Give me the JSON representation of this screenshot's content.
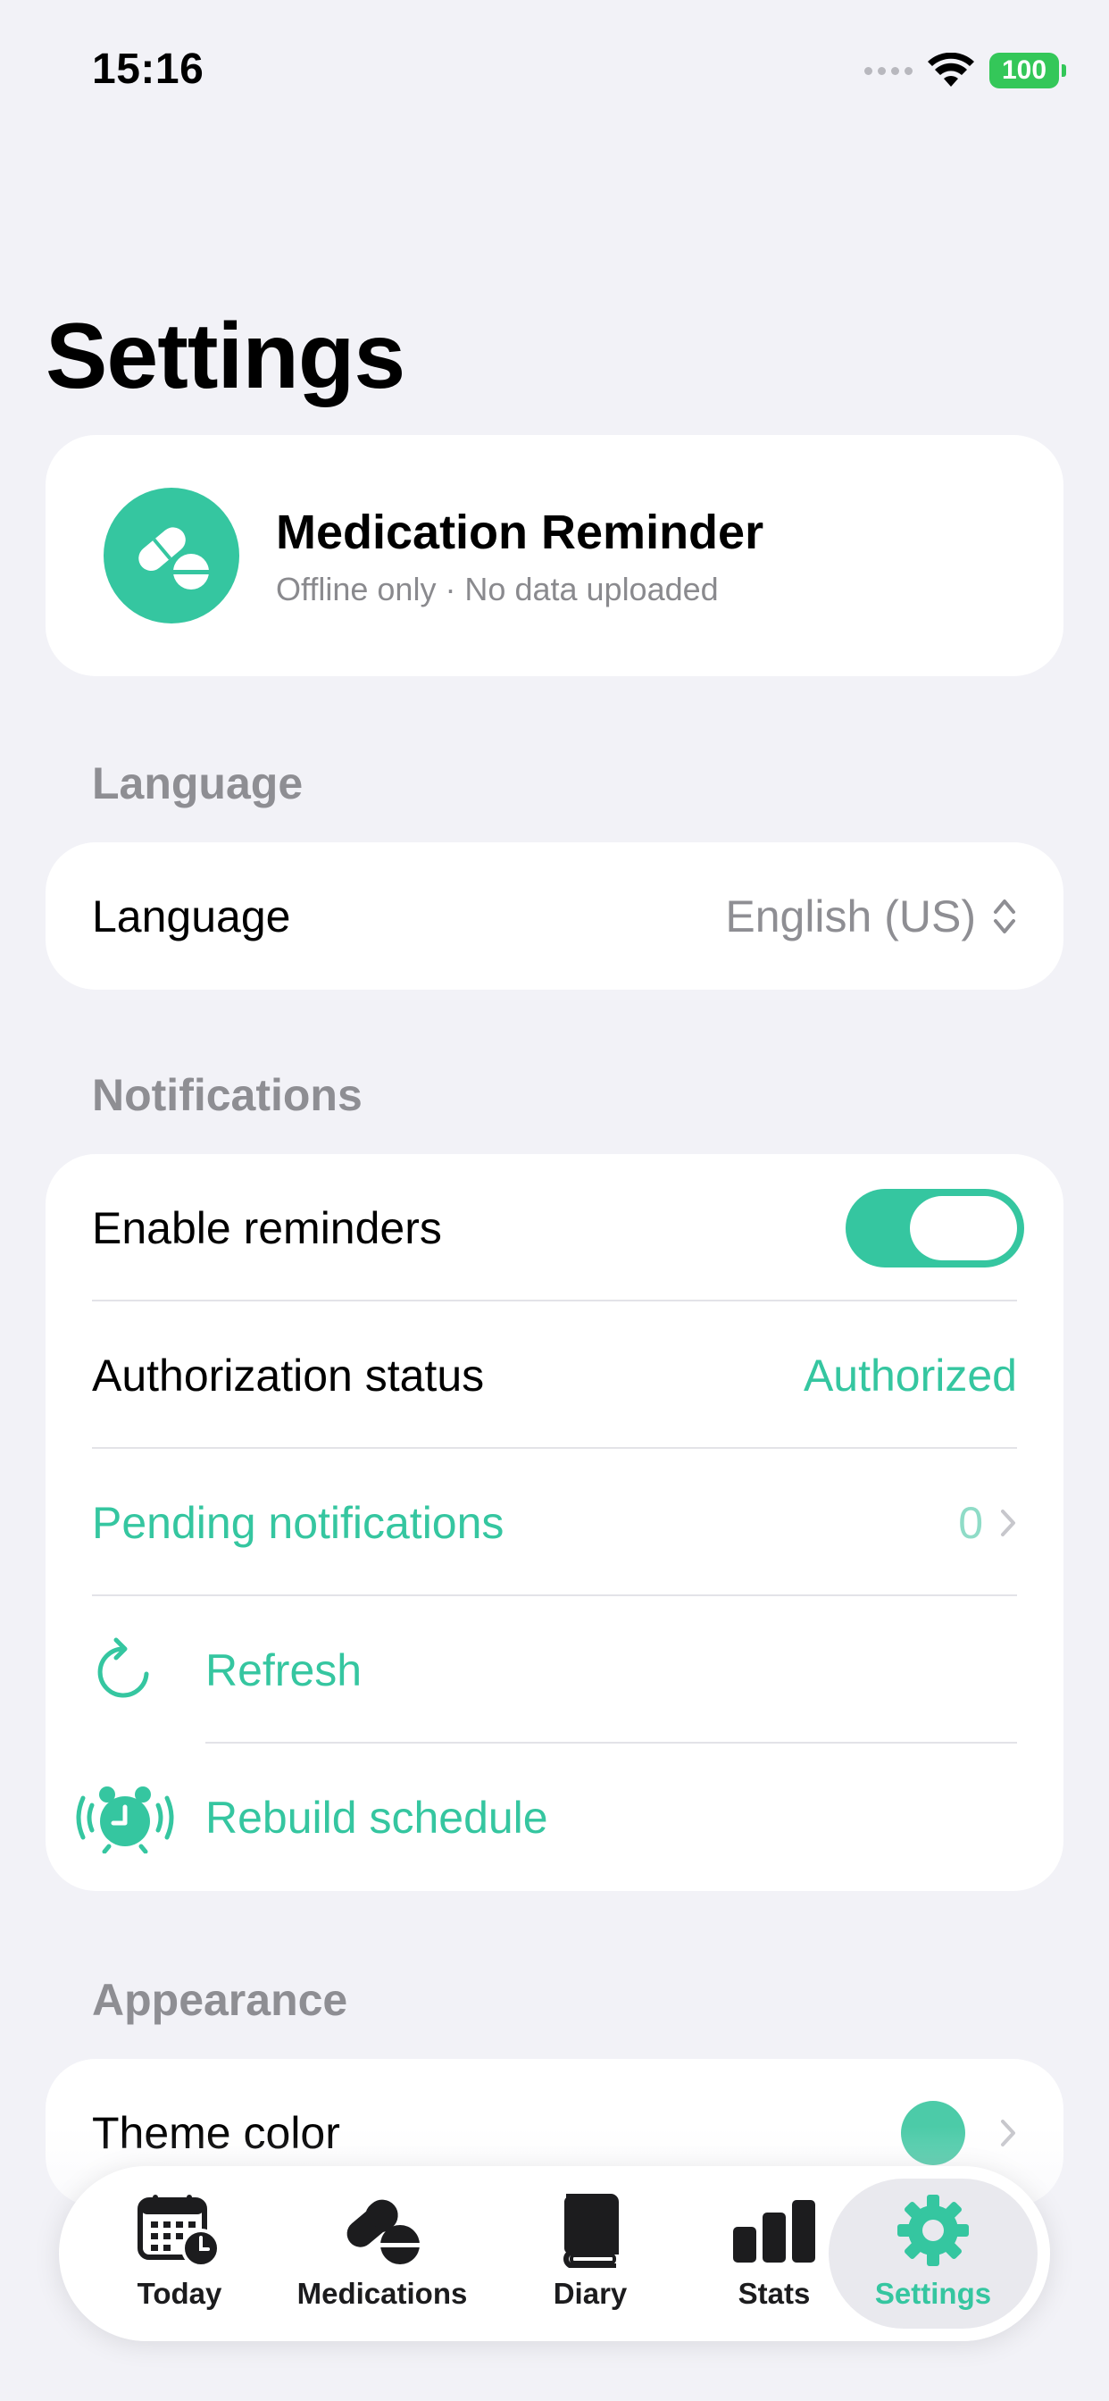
{
  "status_bar": {
    "time": "15:16",
    "battery": "100"
  },
  "page": {
    "title": "Settings"
  },
  "app_card": {
    "name": "Medication Reminder",
    "subtitle": "Offline only · No data uploaded",
    "icon": "pill-icon",
    "icon_color": "#35C6A0"
  },
  "sections": {
    "language": {
      "header": "Language",
      "row_label": "Language",
      "row_value": "English (US)"
    },
    "notifications": {
      "header": "Notifications",
      "enable_reminders": {
        "label": "Enable reminders",
        "enabled": true
      },
      "authorization": {
        "label": "Authorization status",
        "value": "Authorized"
      },
      "pending": {
        "label": "Pending notifications",
        "value": "0"
      },
      "refresh": {
        "label": "Refresh"
      },
      "rebuild": {
        "label": "Rebuild schedule"
      }
    },
    "appearance": {
      "header": "Appearance",
      "theme_color": {
        "label": "Theme color",
        "color": "#4CCBA8"
      }
    }
  },
  "tab_bar": {
    "tabs": [
      {
        "label": "Today",
        "icon": "calendar-clock-icon"
      },
      {
        "label": "Medications",
        "icon": "pills-icon"
      },
      {
        "label": "Diary",
        "icon": "book-icon"
      },
      {
        "label": "Stats",
        "icon": "bar-chart-icon"
      },
      {
        "label": "Settings",
        "icon": "gear-icon",
        "active": true
      }
    ]
  },
  "colors": {
    "accent": "#35C6A0",
    "background": "#F2F2F7",
    "secondary_text": "#8E8E93"
  }
}
